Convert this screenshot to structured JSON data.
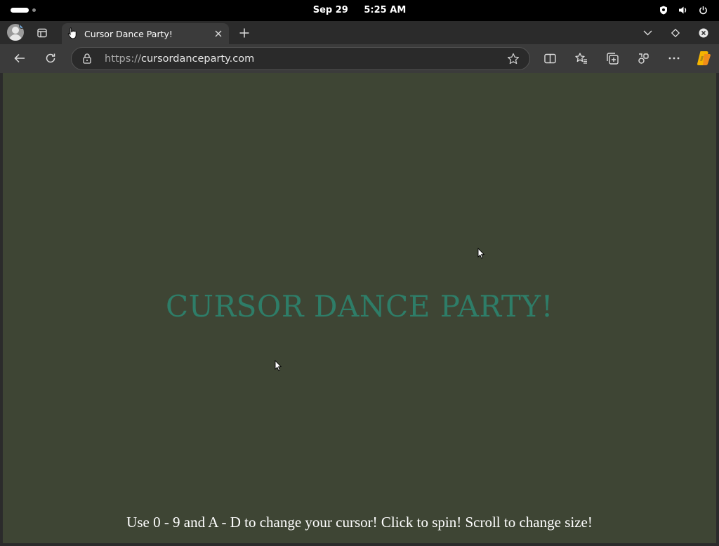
{
  "os": {
    "date": "Sep 29",
    "time": "5:25 AM",
    "tray_icons": [
      "shield-icon",
      "volume-icon",
      "power-icon"
    ]
  },
  "browser": {
    "tab": {
      "title": "Cursor Dance Party!",
      "favicon": "hand-cursor-icon"
    },
    "address": {
      "protocol": "https://",
      "domain": "cursordanceparty.com"
    },
    "toolbar_icons": [
      "back-icon",
      "refresh-icon",
      "split-screen-icon",
      "favorites-icon",
      "collections-icon",
      "extensions-icon",
      "more-icon",
      "copilot-icon"
    ]
  },
  "page": {
    "headline": "CURSOR DANCE PARTY!",
    "instructions": "Use 0 - 9 and A - D to change your cursor! Click to spin! Scroll to change size!",
    "background_color": "#3e4534",
    "headline_color": "#2e7d68"
  }
}
